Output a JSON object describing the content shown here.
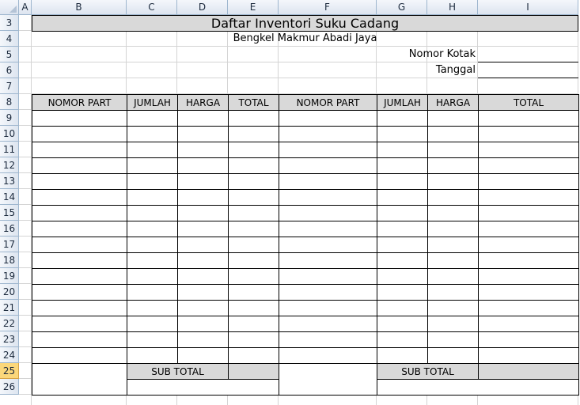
{
  "sheet": {
    "columns": [
      "A",
      "B",
      "C",
      "D",
      "E",
      "F",
      "G",
      "H",
      "I"
    ],
    "rows": [
      "3",
      "4",
      "5",
      "6",
      "7",
      "8",
      "9",
      "10",
      "11",
      "12",
      "13",
      "14",
      "15",
      "16",
      "17",
      "18",
      "19",
      "20",
      "21",
      "22",
      "23",
      "24",
      "25",
      "26"
    ],
    "selected_row": "25"
  },
  "doc": {
    "title": "Daftar Inventori Suku Cadang",
    "subtitle": "Bengkel Makmur Abadi Jaya",
    "nomor_kotak_label": "Nomor Kotak",
    "tanggal_label": "Tanggal",
    "nomor_kotak_value": "",
    "tanggal_value": ""
  },
  "table": {
    "headers": [
      "NOMOR PART",
      "JUMLAH",
      "HARGA",
      "TOTAL",
      "NOMOR PART",
      "JUMLAH",
      "HARGA",
      "TOTAL"
    ],
    "sub_total_left": "SUB TOTAL",
    "sub_total_right": "SUB TOTAL"
  }
}
